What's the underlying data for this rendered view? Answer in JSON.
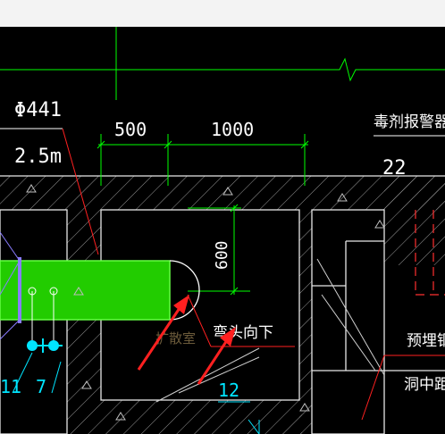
{
  "window": {
    "title": ""
  },
  "labels": {
    "pipe_diameter": "Φ441",
    "pipe_length": "2.5m",
    "dim_500": "500",
    "dim_1000": "1000",
    "dim_600": "600",
    "detector_label": "毒剂报警器",
    "detector_num": "22",
    "elbow_down": "弯头向下",
    "chamber_label": "扩散室",
    "num_11": "11",
    "num_7": "7",
    "num_12": "12",
    "embedded_pipe": "预埋钢管",
    "tunnel_dist": "洞中距地"
  },
  "colors": {
    "background": "#000000",
    "pipe": "#22cc00",
    "dimension": "#00ff00",
    "annotation": "#ffffff",
    "leader_red": "#ff2020",
    "cyan": "#00e5ff",
    "violet": "#8a7cff"
  }
}
